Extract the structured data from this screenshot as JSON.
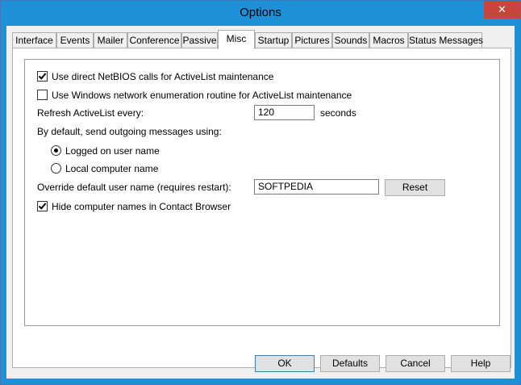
{
  "window": {
    "title": "Options",
    "close_glyph": "✕"
  },
  "tabs": [
    {
      "label": "Interface"
    },
    {
      "label": "Events"
    },
    {
      "label": "Mailer"
    },
    {
      "label": "Conference"
    },
    {
      "label": "Passive"
    },
    {
      "label": "Misc"
    },
    {
      "label": "Startup"
    },
    {
      "label": "Pictures"
    },
    {
      "label": "Sounds"
    },
    {
      "label": "Macros"
    },
    {
      "label": "Status Messages"
    }
  ],
  "active_tab": "Misc",
  "misc": {
    "use_netbios": {
      "label": "Use direct NetBIOS calls for ActiveList maintenance",
      "checked": true
    },
    "use_windows_enum": {
      "label": "Use Windows network enumeration routine for ActiveList maintenance",
      "checked": false
    },
    "refresh": {
      "label": "Refresh ActiveList every:",
      "value": "120",
      "unit": "seconds"
    },
    "send_as_label": "By default, send outgoing messages using:",
    "send_as_options": [
      {
        "label": "Logged on user name",
        "selected": true
      },
      {
        "label": "Local computer name",
        "selected": false
      }
    ],
    "override": {
      "label": "Override default user name (requires restart):",
      "value": "SOFTPEDIA",
      "reset_label": "Reset"
    },
    "hide_names": {
      "label": "Hide computer names in Contact Browser",
      "checked": true
    }
  },
  "buttons": {
    "ok": "OK",
    "defaults": "Defaults",
    "cancel": "Cancel",
    "help": "Help"
  }
}
